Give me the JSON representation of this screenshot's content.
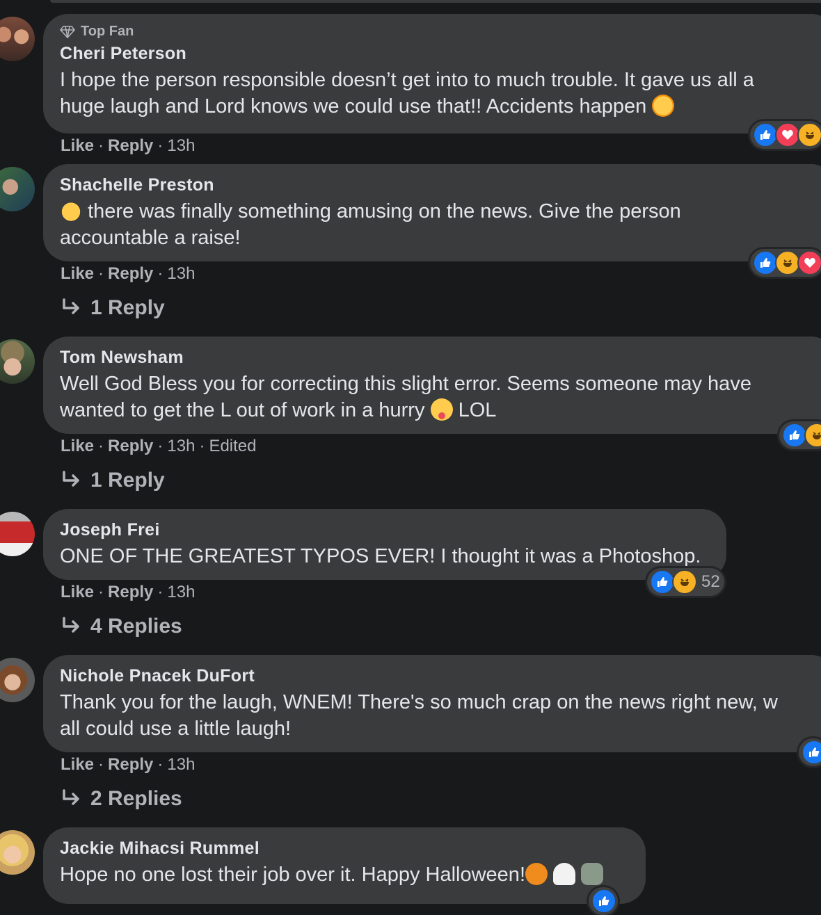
{
  "comments": [
    {
      "badge": "Top Fan",
      "name": "Cheri Peterson",
      "text1": "I hope the person responsible doesn’t get into to much trouble. It gave us all a",
      "text2": "huge laugh and Lord knows we could use that!! Accidents happen",
      "like": "Like",
      "reply": "Reply",
      "time": "13h",
      "reactions": [
        "like",
        "love",
        "haha"
      ]
    },
    {
      "name": "Shachelle Preston",
      "text1": "there was finally something amusing on the news. Give the person",
      "text2": "accountable a raise!",
      "like": "Like",
      "reply": "Reply",
      "time": "13h",
      "replies": "1 Reply",
      "reactions": [
        "like",
        "haha",
        "love"
      ]
    },
    {
      "name": "Tom Newsham",
      "text1": "Well God Bless you for correcting this slight error. Seems someone may have",
      "text2a": "wanted to get the L out of work in a hurry",
      "text2b": "LOL",
      "like": "Like",
      "reply": "Reply",
      "time": "13h",
      "edited": "Edited",
      "replies": "1 Reply",
      "reactions": [
        "like",
        "haha"
      ]
    },
    {
      "name": "Joseph Frei",
      "text1": "ONE OF THE GREATEST TYPOS EVER! I thought it was a Photoshop.",
      "like": "Like",
      "reply": "Reply",
      "time": "13h",
      "replies": "4 Replies",
      "reactions": [
        "like",
        "haha"
      ],
      "reaction_count": "52"
    },
    {
      "name": "Nichole Pnacek DuFort",
      "text1": "Thank you for the laugh, WNEM! There's so much crap on the news right new, w",
      "text2": "all could use a little laugh!",
      "like": "Like",
      "reply": "Reply",
      "time": "13h",
      "replies": "2 Replies",
      "reactions": [
        "like"
      ]
    },
    {
      "name": "Jackie Mihacsi Rummel",
      "text1": "Hope no one lost their job over it. Happy Halloween!",
      "reactions": [
        "like"
      ]
    }
  ],
  "colors": {
    "background": "#18191a",
    "bubble": "#3a3b3c",
    "like": "#1877f2",
    "love": "#f33e58",
    "haha": "#f7b125"
  },
  "icons": [
    "diamond-icon",
    "reply-arrow-icon",
    "like-reaction-icon",
    "love-reaction-icon",
    "haha-reaction-icon"
  ]
}
